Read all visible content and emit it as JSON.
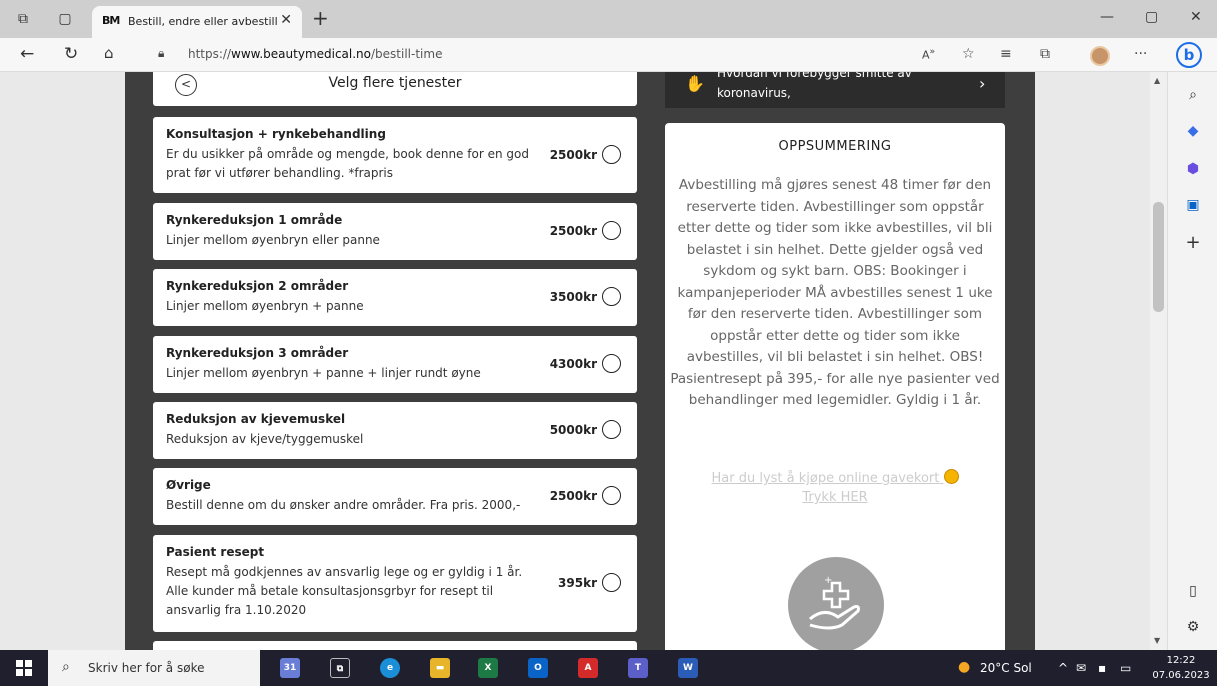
{
  "browser": {
    "tab_title": "Bestill, endre eller avbestill time",
    "tab_favicon": "BM",
    "url_prefix": "https://",
    "url_domain": "www.beautymedical.no",
    "url_path": "/bestill-time"
  },
  "page": {
    "header_title": "Velg flere tjenester",
    "news_text": "koronavirus,",
    "news_hidden_text": "Hvordan vi forebygger smitte av",
    "services": [
      {
        "name": "Konsultasjon + rynkebehandling",
        "desc": "Er du usikker på område og mengde, book denne for en god prat før vi utfører behandling. *frapris",
        "price": "2500kr"
      },
      {
        "name": "Rynkereduksjon 1 område",
        "desc": "Linjer mellom øyenbryn eller panne",
        "price": "2500kr"
      },
      {
        "name": "Rynkereduksjon 2 områder",
        "desc": "Linjer mellom øyenbryn + panne",
        "price": "3500kr"
      },
      {
        "name": "Rynkereduksjon 3 områder",
        "desc": "Linjer mellom øyenbryn + panne + linjer rundt øyne",
        "price": "4300kr"
      },
      {
        "name": "Reduksjon av kjevemuskel",
        "desc": "Reduksjon av kjeve/tyggemuskel",
        "price": "5000kr"
      },
      {
        "name": "Øvrige",
        "desc": "Bestill denne om du ønsker andre områder. Fra pris. 2000,-",
        "price": "2500kr"
      },
      {
        "name": "Pasient resept",
        "desc": "Resept må godkjennes av ansvarlig lege og er gyldig i 1 år. Alle kunder må betale konsultasjonsgrbyr for resept til ansvarlig fra 1.10.2020",
        "price": "395kr"
      }
    ],
    "summary": {
      "title": "OPPSUMMERING",
      "body": "Avbestilling må gjøres senest 48 timer før den reserverte tiden. Avbestillinger som oppstår etter dette og tider som ikke avbestilles, vil bli belastet i sin helhet. Dette gjelder også ved sykdom og sykt barn. OBS: Bookinger i kampanjeperioder MÅ avbestilles senest 1 uke før den reserverte tiden. Avbestillinger som oppstår etter dette og tider som ikke avbestilles, vil bli belastet i sin helhet. OBS! Pasientresept på 395,- for alle nye pasienter ved behandlinger med legemidler. Gyldig i 1 år.",
      "link_text": "Har du lyst å kjøpe online gavekort",
      "link_text2": "Trykk HER"
    }
  },
  "taskbar": {
    "search_placeholder": "Skriv her for å søke",
    "weather": "20°C Sol",
    "time": "12:22",
    "date": "07.06.2023"
  },
  "colors": {
    "dark_column": "#3e3e3e",
    "bing_blue": "#1b6ee8",
    "taskbar": "#1f1f2e"
  }
}
